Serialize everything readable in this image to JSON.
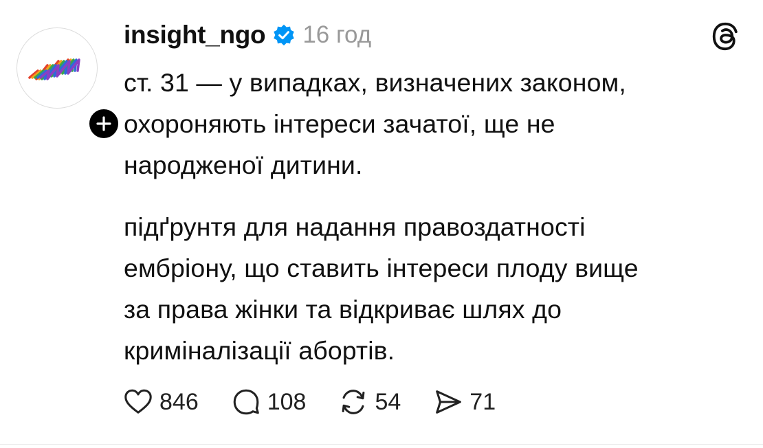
{
  "author": {
    "username": "insight_ngo",
    "verified": true,
    "avatar_icon": "rainbow-wave-logo",
    "follow_icon": "plus-icon"
  },
  "post": {
    "time_ago": "16 год",
    "paragraph1": [
      "ст. 31 — у випадках, визначених законом,",
      "охороняють інтереси зачатої, ще не",
      "народженої дитини."
    ],
    "paragraph2": [
      "підґрунтя для надання правоздатності",
      "ембріону, що ставить інтереси плоду вище",
      "за права жінки та відкриває шлях до",
      "криміналізації абортів."
    ]
  },
  "actions": {
    "likes": "846",
    "replies": "108",
    "reposts": "54",
    "shares": "71"
  },
  "colors": {
    "verified": "#0095f6",
    "muted": "#999999",
    "text": "#111111"
  }
}
